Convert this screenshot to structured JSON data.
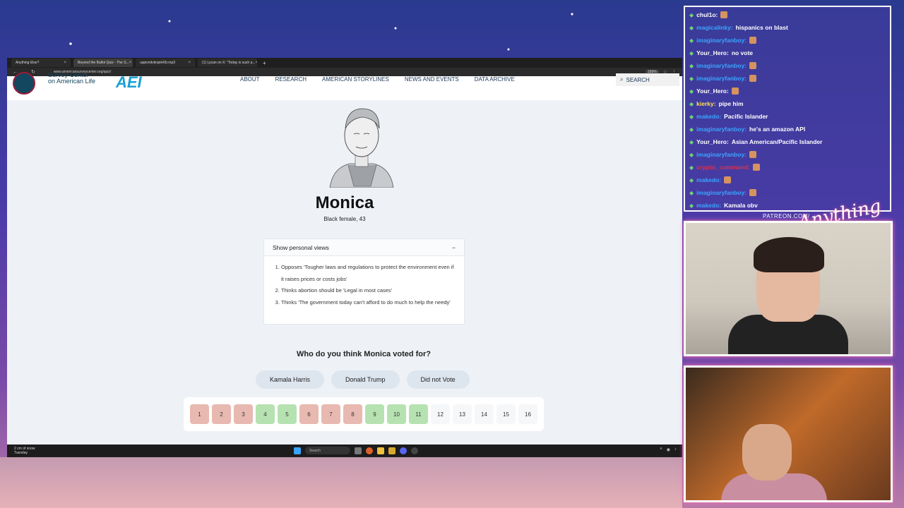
{
  "browser": {
    "tabs": [
      {
        "title": "Anything Else?"
      },
      {
        "title": "Beyond the Ballot Quiz - The S..."
      },
      {
        "title": "uajsvndvkrqnk43r.mp3"
      },
      {
        "title": "(1) Lycan on X: \"Today is such a..."
      }
    ],
    "new_tab": "+",
    "url": "www.americansurveycenter.org/quiz/",
    "zoom": "150%"
  },
  "site": {
    "logo_line1": "Survey Center",
    "logo_line2": "on American Life",
    "logo_aei": "AEI",
    "nav": [
      "ABOUT",
      "RESEARCH",
      "AMERICAN STORYLINES",
      "NEWS AND EVENTS",
      "DATA ARCHIVE"
    ],
    "search_label": "SEARCH"
  },
  "quiz": {
    "name": "Monica",
    "demographic": "Black female, 43",
    "views_toggle": "Show personal views",
    "views_toggle_icon": "−",
    "views": [
      "Opposes 'Tougher laws and regulations to protect the environment even if it raises prices or costs jobs'",
      "Thinks abortion should be 'Legal in most cases'",
      "Thinks 'The government today can't afford to do much to help the needy'"
    ],
    "question": "Who do you think Monica voted for?",
    "choices": [
      "Kamala Harris",
      "Donald Trump",
      "Did not Vote"
    ],
    "pages": [
      {
        "n": "1",
        "status": "wrong"
      },
      {
        "n": "2",
        "status": "wrong"
      },
      {
        "n": "3",
        "status": "wrong"
      },
      {
        "n": "4",
        "status": "correct"
      },
      {
        "n": "5",
        "status": "correct"
      },
      {
        "n": "6",
        "status": "wrong"
      },
      {
        "n": "7",
        "status": "wrong"
      },
      {
        "n": "8",
        "status": "wrong"
      },
      {
        "n": "9",
        "status": "correct"
      },
      {
        "n": "10",
        "status": "correct"
      },
      {
        "n": "11",
        "status": "correct"
      },
      {
        "n": "12",
        "status": "none"
      },
      {
        "n": "13",
        "status": "none"
      },
      {
        "n": "14",
        "status": "none"
      },
      {
        "n": "15",
        "status": "none"
      },
      {
        "n": "16",
        "status": "none"
      }
    ]
  },
  "taskbar": {
    "weather_line1": "2 cm of snow",
    "weather_line2": "Tuesday",
    "search": "Search"
  },
  "chat": {
    "messages": [
      {
        "user": "chul1o:",
        "text": "",
        "user_color": "#ffffff",
        "emote": true
      },
      {
        "user": "magicalinky:",
        "text": "hispanics on blast",
        "user_color": "#3aa5ff",
        "emote": false
      },
      {
        "user": "imaginaryfanboy:",
        "text": "",
        "user_color": "#3aa5ff",
        "emote": true
      },
      {
        "user": "Your_Hero:",
        "text": "no vote",
        "user_color": "#ffffff",
        "emote": false
      },
      {
        "user": "imaginaryfanboy:",
        "text": "",
        "user_color": "#3aa5ff",
        "emote": true
      },
      {
        "user": "imaginaryfanboy:",
        "text": "",
        "user_color": "#3aa5ff",
        "emote": true
      },
      {
        "user": "Your_Hero:",
        "text": "",
        "user_color": "#ffffff",
        "emote": true
      },
      {
        "user": "kierky:",
        "text": "pipe him",
        "user_color": "#ffe14a",
        "emote": false
      },
      {
        "user": "makedo:",
        "text": "Pacific Islander",
        "user_color": "#3aa5ff",
        "emote": false
      },
      {
        "user": "imaginaryfanboy:",
        "text": "he's an amazon API",
        "user_color": "#3aa5ff",
        "emote": false
      },
      {
        "user": "Your_Hero:",
        "text": "Asian American/Pacific Islander",
        "user_color": "#ffffff",
        "emote": false
      },
      {
        "user": "imaginaryfanboy:",
        "text": "",
        "user_color": "#3aa5ff",
        "emote": true
      },
      {
        "user": "cryptic_command:",
        "text": "",
        "user_color": "#e0304a",
        "emote": true
      },
      {
        "user": "makedo:",
        "text": "",
        "user_color": "#3aa5ff",
        "emote": true
      },
      {
        "user": "imaginaryfanboy:",
        "text": "",
        "user_color": "#3aa5ff",
        "emote": true
      },
      {
        "user": "makedo:",
        "text": "Kamala obv",
        "user_color": "#3aa5ff",
        "emote": false
      }
    ]
  },
  "overlay": {
    "patreon": "PATREON.COM/",
    "brand": "Anything Else?"
  },
  "colors": {
    "wrong": "#e8b9b0",
    "correct": "#b6e2b1",
    "none": "#f5f7f9"
  }
}
